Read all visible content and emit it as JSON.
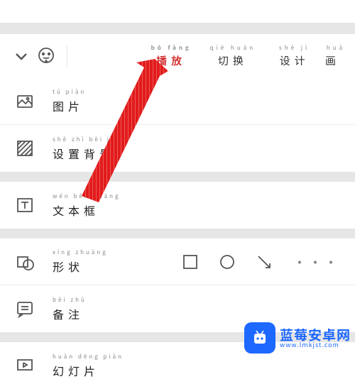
{
  "toolbar": {
    "tabs": [
      {
        "pinyin": "",
        "label": "　",
        "state": "dim"
      },
      {
        "pinyin": "bō fàng",
        "label": "播放",
        "state": "active"
      },
      {
        "pinyin": "qiē huàn",
        "label": "切换",
        "state": ""
      },
      {
        "pinyin": "shè jì",
        "label": "设计",
        "state": ""
      },
      {
        "pinyin": "huà",
        "label": "画",
        "state": "partial"
      }
    ]
  },
  "groups": [
    {
      "rows": [
        {
          "icon": "image",
          "pinyin": "tú piàn",
          "label": "图片"
        },
        {
          "icon": "background",
          "pinyin": "shè zhì bèi jǐng",
          "label": "设置背景"
        }
      ]
    },
    {
      "rows": [
        {
          "icon": "textbox",
          "pinyin": "wén běn kuāng",
          "label": "文本框"
        }
      ]
    },
    {
      "rows": [
        {
          "icon": "shape",
          "pinyin": "xíng zhuàng",
          "label": "形状",
          "extras": true
        },
        {
          "icon": "note",
          "pinyin": "bèi zhù",
          "label": "备注"
        }
      ]
    },
    {
      "rows": [
        {
          "icon": "slideshow",
          "pinyin": "huàn dēng piàn",
          "label": "幻灯片"
        }
      ]
    }
  ],
  "watermark": {
    "title": "蓝莓安卓网",
    "url": "www.lmkjst.com"
  }
}
